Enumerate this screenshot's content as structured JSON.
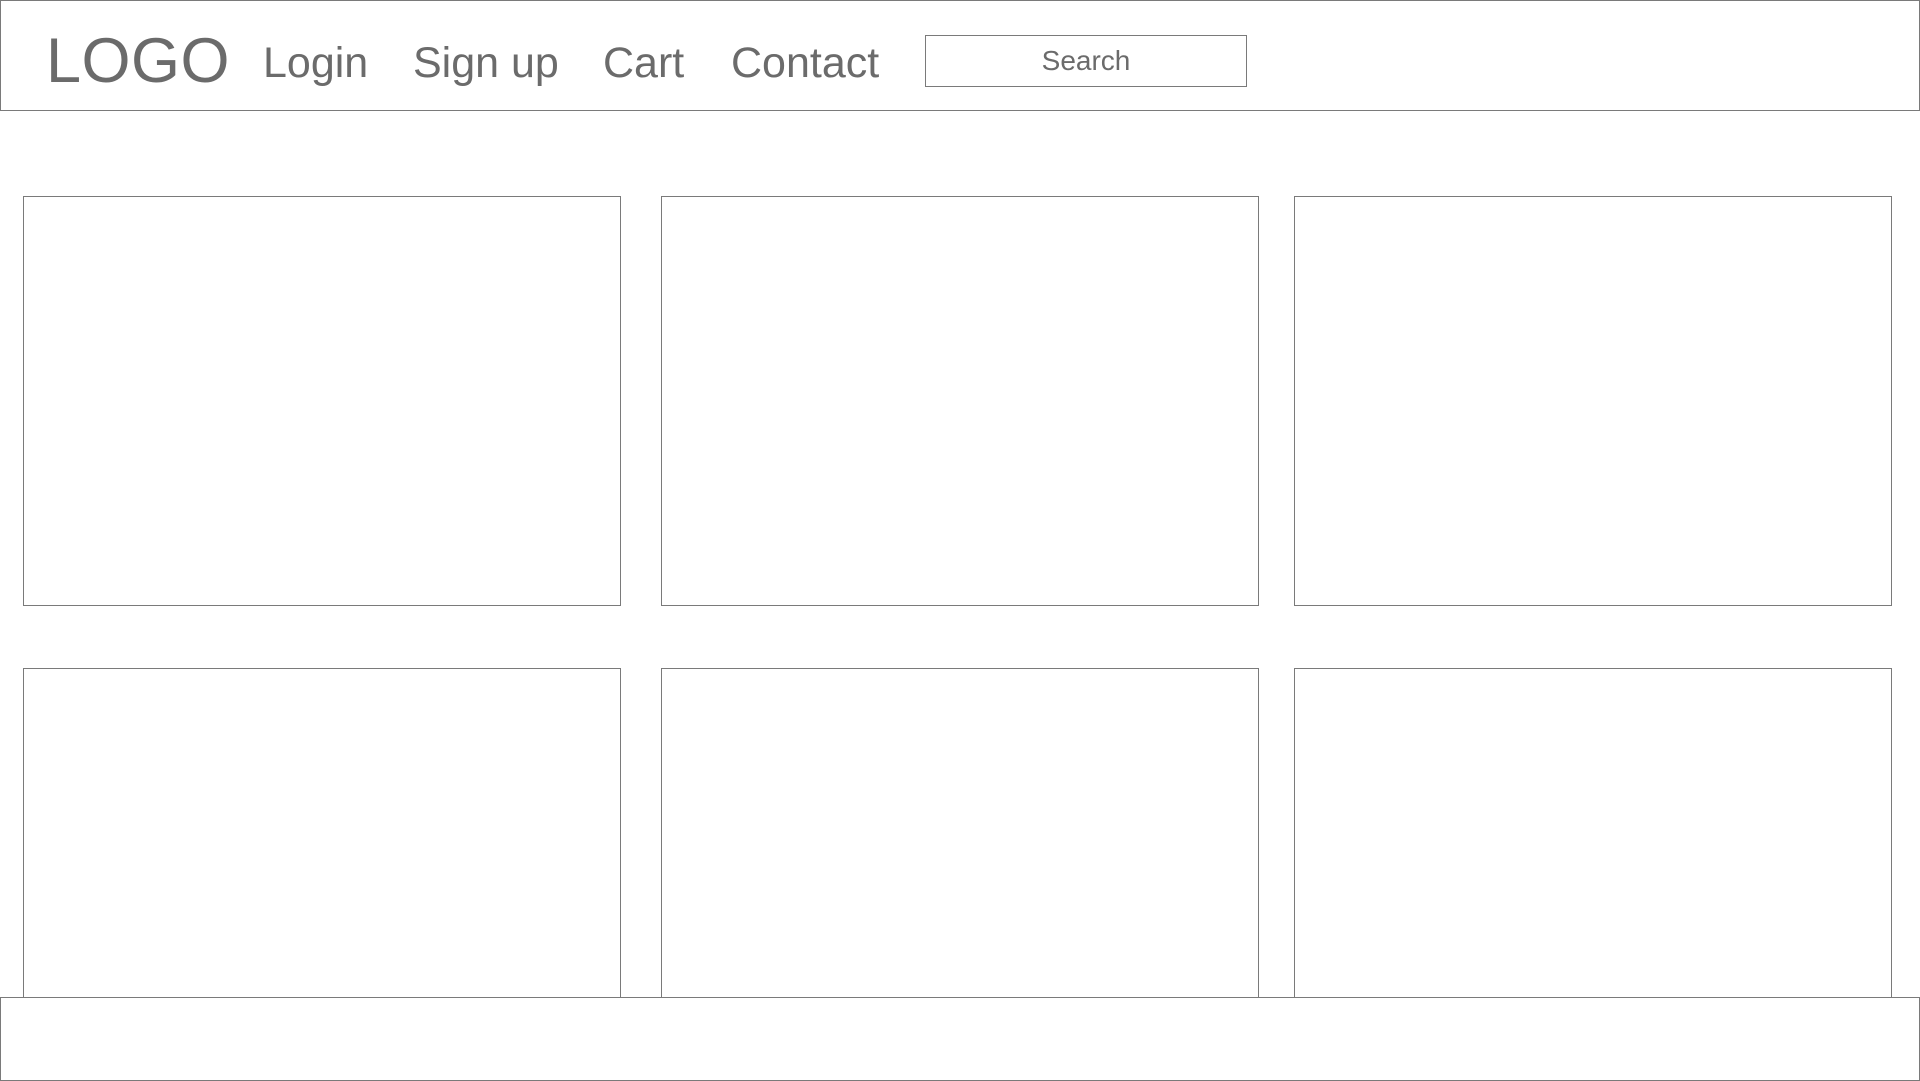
{
  "header": {
    "logo": "LOGO",
    "nav": {
      "login": "Login",
      "signup": "Sign up",
      "cart": "Cart",
      "contact": "Contact"
    },
    "search": {
      "placeholder": "Search"
    }
  },
  "grid": {
    "rows": 2,
    "columns": 3
  },
  "colors": {
    "border": "#7a7a7a",
    "text": "#6b6b6b",
    "background": "#ffffff"
  }
}
